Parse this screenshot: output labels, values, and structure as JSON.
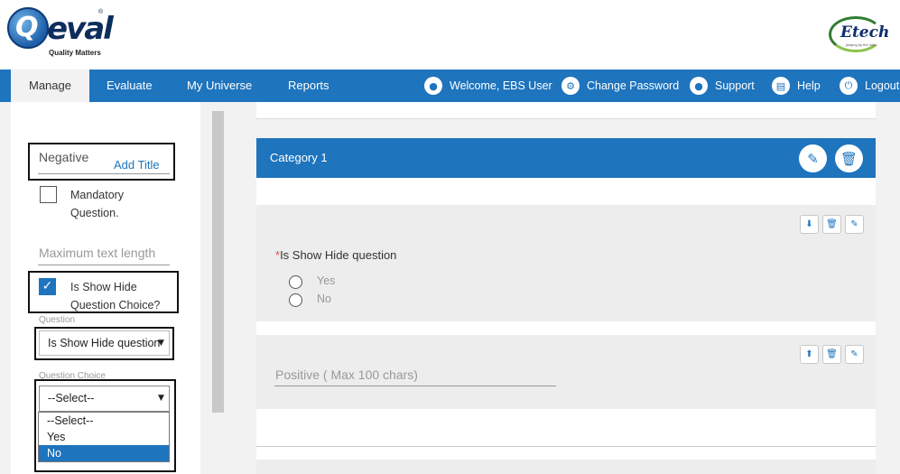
{
  "header": {
    "logo_q": "Q",
    "logo_eval": "eval",
    "logo_reg": "®",
    "logo_tagline": "Quality Matters",
    "brand_right": "Etech",
    "brand_right_sub": "playing by the rules"
  },
  "nav": {
    "tabs": [
      {
        "label": "Manage",
        "active": true
      },
      {
        "label": "Evaluate"
      },
      {
        "label": "My Universe"
      },
      {
        "label": "Reports"
      }
    ],
    "right": [
      {
        "label": "Welcome, EBS User",
        "icon": "user-icon"
      },
      {
        "label": "Change Password",
        "icon": "gear-icon"
      },
      {
        "label": "Support",
        "icon": "user-icon"
      },
      {
        "label": "Help",
        "icon": "book-icon"
      },
      {
        "label": "Logout",
        "icon": "power-icon"
      }
    ]
  },
  "left": {
    "title_value": "Negative",
    "add_title": "Add Title",
    "mandatory_label_1": "Mandatory",
    "mandatory_label_2": "Question.",
    "max_text_placeholder": "Maximum text length",
    "show_hide_label_1": "Is Show Hide",
    "show_hide_label_2": "Question Choice?",
    "show_hide_checked": true,
    "question_label": "Question",
    "question_value": "Is Show Hide question",
    "choice_label": "Question Choice",
    "choice_value": "--Select--",
    "choice_options": [
      "--Select--",
      "Yes",
      "No"
    ],
    "choice_highlighted": "No"
  },
  "main": {
    "category_title": "Category 1",
    "question_text": "Is Show Hide question",
    "required_mark": "*",
    "options": [
      "Yes",
      "No"
    ],
    "positive_placeholder": "Positive ( Max 100 chars)"
  },
  "colors": {
    "primary": "#1e74bd",
    "required": "#d9534f",
    "panel_bg": "#f2f2f2"
  }
}
